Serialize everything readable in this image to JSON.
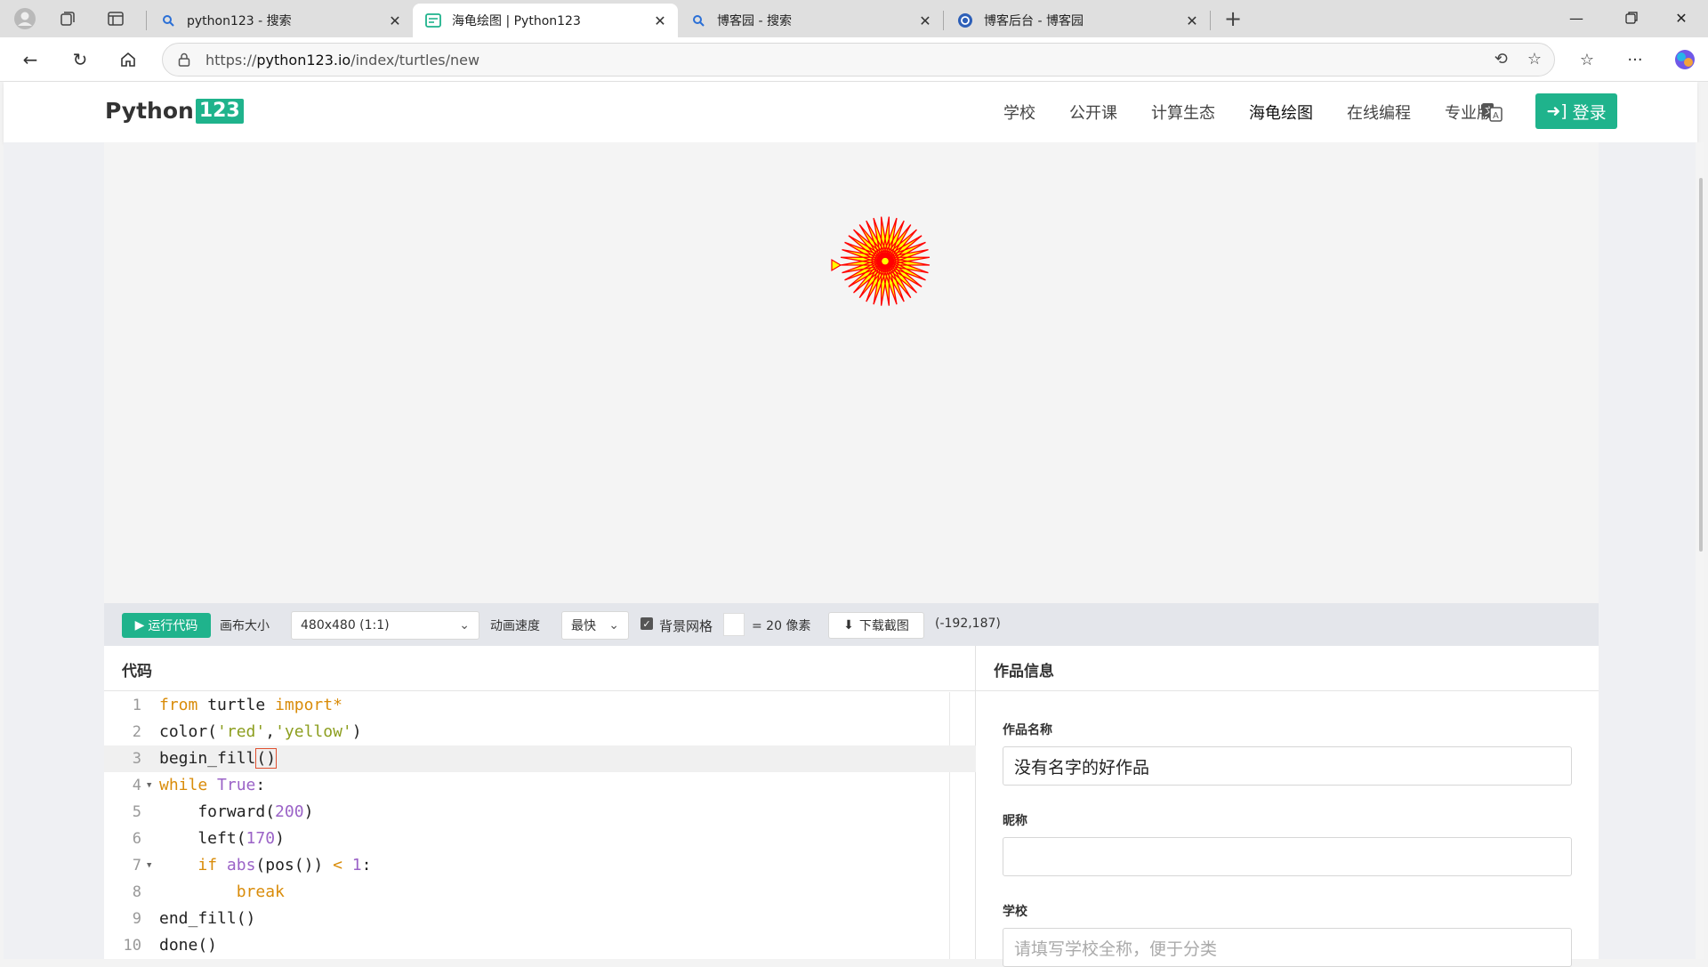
{
  "browser": {
    "tabs": [
      {
        "title": "python123 - 搜索",
        "favicon": "search-icon"
      },
      {
        "title": "海龟绘图 | Python123",
        "favicon": "python123-icon",
        "active": true
      },
      {
        "title": "博客园 - 搜索",
        "favicon": "search-icon"
      },
      {
        "title": "博客后台 - 博客园",
        "favicon": "cnblogs-icon"
      }
    ],
    "url_prefix": "https://",
    "url_host": "python123.io",
    "url_path": "/index/turtles/new"
  },
  "site": {
    "logo_text": "Python",
    "logo_num": "123",
    "nav": [
      "学校",
      "公开课",
      "计算生态",
      "海龟绘图",
      "在线编程",
      "专业版"
    ],
    "active_nav": "海龟绘图",
    "login_label": "登录"
  },
  "toolbar": {
    "run_label": "运行代码",
    "canvas_size_label": "画布大小",
    "canvas_size_value": "480x480 (1:1)",
    "speed_label": "动画速度",
    "speed_value": "最快",
    "grid_label": "背景网格",
    "grid_checked": true,
    "grid_unit": "= 20 像素",
    "download_label": "下载截图",
    "coords": "(-192,187)"
  },
  "code_panel": {
    "title": "代码",
    "lines": [
      "from turtle import*",
      "color('red','yellow')",
      "begin_fill()",
      "while True:",
      "    forward(200)",
      "    left(170)",
      "    if abs(pos()) < 1:",
      "        break",
      "end_fill()",
      "done()"
    ],
    "current_line": 3
  },
  "info_panel": {
    "title": "作品信息",
    "work_name_label": "作品名称",
    "work_name_value": "没有名字的好作品",
    "nickname_label": "昵称",
    "nickname_value": "",
    "school_label": "学校",
    "school_placeholder": "请填写学校全称，便于分类"
  },
  "drawing": {
    "stroke_color": "#ff0000",
    "fill_color": "#ffff00",
    "step": 200,
    "turn": 170
  }
}
